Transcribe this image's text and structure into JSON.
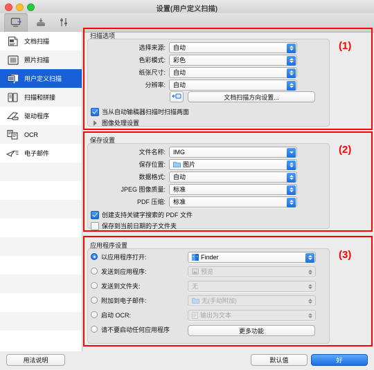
{
  "window": {
    "title": "设置(用户定义扫描)"
  },
  "toolbar": {
    "items": [
      {
        "name": "scan-from-computer-tab",
        "selected": true
      },
      {
        "name": "scan-from-operation-panel-tab",
        "selected": false
      },
      {
        "name": "general-settings-tab",
        "selected": false
      }
    ]
  },
  "sidebar": {
    "items": [
      {
        "label": "文档扫描",
        "icon": "document-scan-icon",
        "selected": false
      },
      {
        "label": "照片扫描",
        "icon": "photo-scan-icon",
        "selected": false
      },
      {
        "label": "用户定义扫描",
        "icon": "custom-scan-icon",
        "selected": true
      },
      {
        "label": "扫描和拼接",
        "icon": "scan-and-stitch-icon",
        "selected": false
      },
      {
        "label": "驱动程序",
        "icon": "driver-icon",
        "selected": false
      },
      {
        "label": "OCR",
        "icon": "ocr-icon",
        "selected": false
      },
      {
        "label": "电子邮件",
        "icon": "email-icon",
        "selected": false
      }
    ]
  },
  "scan_options": {
    "title": "扫描选项",
    "annotation": "(1)",
    "fields": [
      {
        "label": "选择来源:",
        "value": "自动"
      },
      {
        "label": "色彩模式:",
        "value": "彩色"
      },
      {
        "label": "纸张尺寸:",
        "value": "自动"
      },
      {
        "label": "分辨率:",
        "value": "自动"
      }
    ],
    "orientation_button": "文档扫描方向设置...",
    "orientation_icon": "orientation-icon",
    "duplex_checkbox": {
      "label": "当从自动输稿器扫描时扫描两面",
      "checked": true
    },
    "image_processing": "图像处理设置"
  },
  "save_settings": {
    "title": "保存设置",
    "annotation": "(2)",
    "fields": [
      {
        "label": "文件名称:",
        "value": "IMG",
        "type": "combo",
        "icon": ""
      },
      {
        "label": "保存位置:",
        "value": "图片",
        "type": "popup",
        "icon": "folder-icon"
      },
      {
        "label": "数据格式:",
        "value": "自动",
        "type": "popup",
        "icon": ""
      },
      {
        "label": "JPEG 图像质量:",
        "value": "标准",
        "type": "popup",
        "icon": ""
      },
      {
        "label": "PDF 压缩:",
        "value": "标准",
        "type": "popup",
        "icon": ""
      }
    ],
    "checkboxes": [
      {
        "label": "创建支持关键字搜索的 PDF 文件",
        "checked": true
      },
      {
        "label": "保存到当前日期的子文件夹",
        "checked": false
      }
    ]
  },
  "application_settings": {
    "title": "应用程序设置",
    "annotation": "(3)",
    "options": [
      {
        "label": "以应用程序打开:",
        "selected": true,
        "value": "Finder",
        "enabled": true,
        "icon": "finder-icon"
      },
      {
        "label": "发送到应用程序:",
        "selected": false,
        "value": "预览",
        "enabled": false,
        "icon": "preview-icon"
      },
      {
        "label": "发送到文件夹:",
        "selected": false,
        "value": "无",
        "enabled": false,
        "icon": ""
      },
      {
        "label": "附加到电子邮件:",
        "selected": false,
        "value": "无(手动附加)",
        "enabled": false,
        "icon": "folder-icon"
      },
      {
        "label": "启动 OCR:",
        "selected": false,
        "value": "输出为文本",
        "enabled": false,
        "icon": "text-icon"
      }
    ],
    "no_app_option": {
      "label": "请不要启动任何应用程序",
      "selected": false
    },
    "more_functions_button": "更多功能"
  },
  "footer": {
    "instructions_button": "用法说明",
    "defaults_button": "默认值",
    "ok_button": "好"
  },
  "colors": {
    "accent": "#1b6fe0",
    "selection": "#1860d8",
    "annotation": "#ff0000"
  }
}
